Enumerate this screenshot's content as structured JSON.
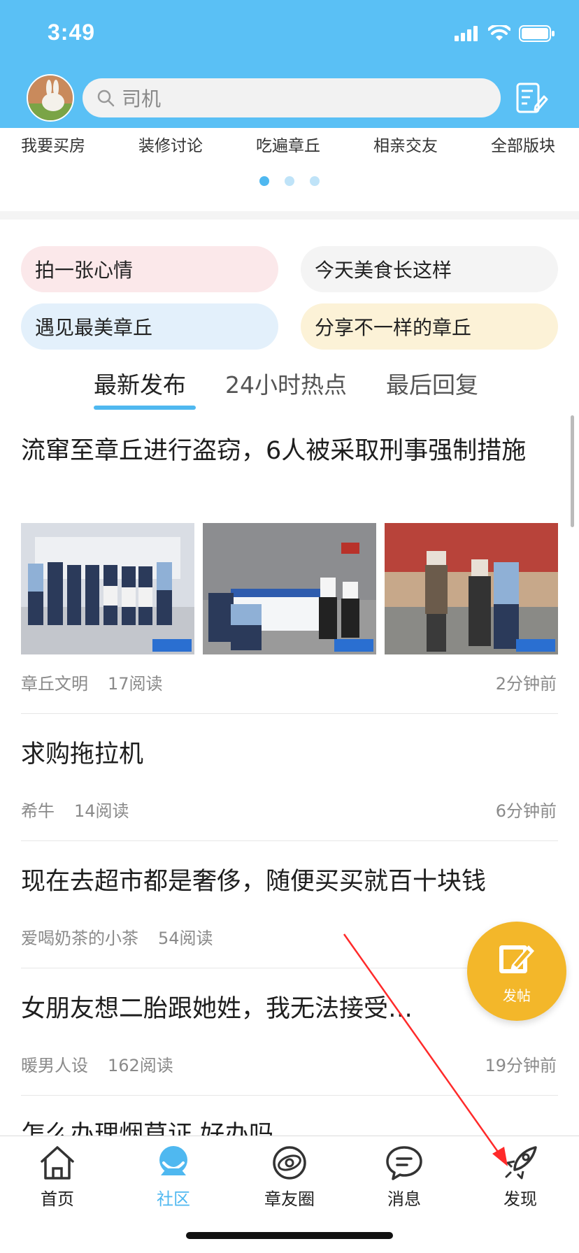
{
  "status_bar": {
    "time": "3:49"
  },
  "search": {
    "placeholder": "司机"
  },
  "categories": [
    "我要买房",
    "装修讨论",
    "吃遍章丘",
    "相亲交友",
    "全部版块"
  ],
  "topics": [
    {
      "label": "拍一张心情",
      "color": "#fbe8ea"
    },
    {
      "label": "今天美食长这样",
      "color": "#f4f4f4"
    },
    {
      "label": "遇见最美章丘",
      "color": "#e3f0fb"
    },
    {
      "label": "分享不一样的章丘",
      "color": "#fcf2d7"
    }
  ],
  "tabs": [
    {
      "label": "最新发布",
      "active": true
    },
    {
      "label": "24小时热点",
      "active": false
    },
    {
      "label": "最后回复",
      "active": false
    }
  ],
  "posts": [
    {
      "title": "流窜至章丘进行盗窃，6人被采取刑事强制措施",
      "author": "章丘文明",
      "reads": "17阅读",
      "time": "2分钟前",
      "has_images": true
    },
    {
      "title": "求购拖拉机",
      "author": "希牛",
      "reads": "14阅读",
      "time": "6分钟前"
    },
    {
      "title": "现在去超市都是奢侈，随便买买就百十块钱",
      "author": "爱喝奶茶的小茶",
      "reads": "54阅读",
      "time": ""
    },
    {
      "title": "女朋友想二胎跟她姓，我无法接受…",
      "author": "暖男人设",
      "reads": "162阅读",
      "time": "19分钟前"
    },
    {
      "title": "怎么办理烟草证 好办吗",
      "author": "",
      "reads": "",
      "time": ""
    }
  ],
  "fab": {
    "label": "发帖"
  },
  "nav": [
    {
      "label": "首页",
      "icon": "home-icon",
      "active": false
    },
    {
      "label": "社区",
      "icon": "community-icon",
      "active": true
    },
    {
      "label": "章友圈",
      "icon": "planet-icon",
      "active": false
    },
    {
      "label": "消息",
      "icon": "message-icon",
      "active": false
    },
    {
      "label": "发现",
      "icon": "rocket-icon",
      "active": false
    }
  ],
  "colors": {
    "header": "#5ac0f5",
    "accent": "#4fb8f0",
    "fab": "#f3b72a",
    "annotation_arrow": "#ff2a2a"
  }
}
